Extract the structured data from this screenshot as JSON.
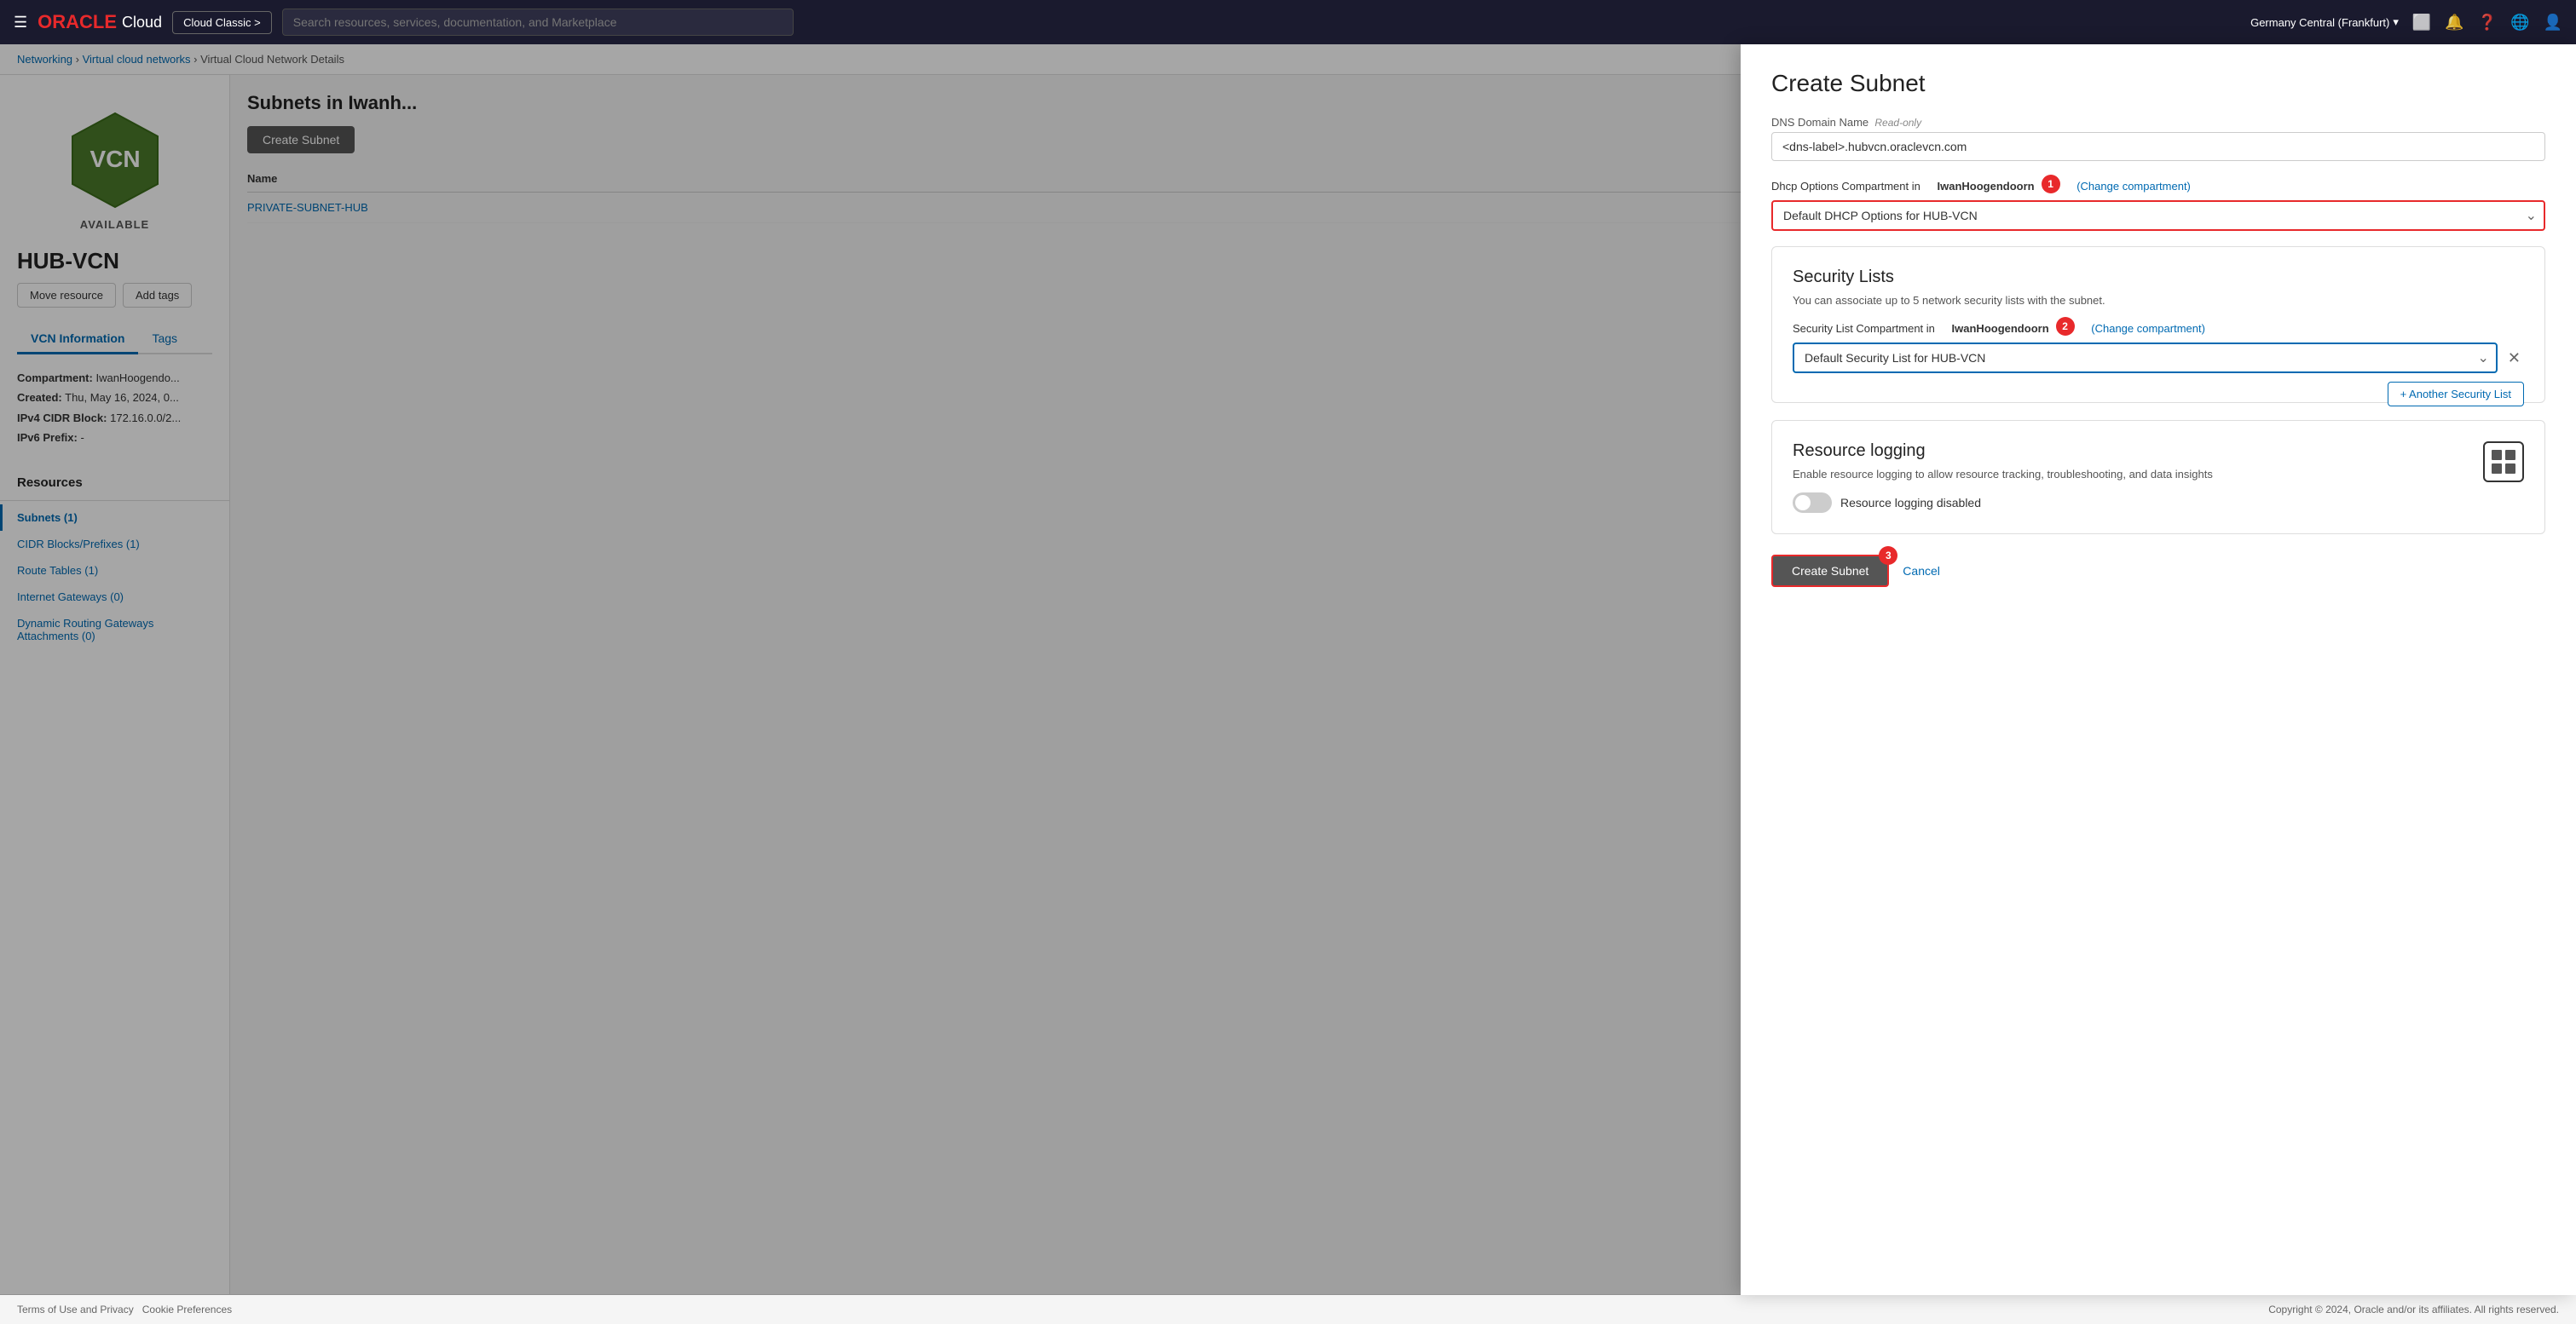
{
  "topnav": {
    "hamburger": "☰",
    "logo_oracle": "ORACLE",
    "logo_cloud": "Cloud",
    "classic_btn": "Cloud Classic >",
    "search_placeholder": "Search resources, services, documentation, and Marketplace",
    "region": "Germany Central (Frankfurt)",
    "region_arrow": "▾"
  },
  "breadcrumb": {
    "networking": "Networking",
    "separator1": " › ",
    "vcn": "Virtual cloud networks",
    "separator2": " › ",
    "detail": "Virtual Cloud Network Details"
  },
  "sidebar": {
    "vcn_label": "VCN",
    "vcn_status": "AVAILABLE",
    "vcn_title": "HUB-VCN",
    "move_resource": "Move resource",
    "add_tags": "Add tags",
    "tab_info": "VCN Information",
    "tab_tags": "Tags",
    "compartment_label": "Compartment:",
    "compartment_value": "IwanHoogendo...",
    "created_label": "Created:",
    "created_value": "Thu, May 16, 2024, 0...",
    "ipv4_label": "IPv4 CIDR Block:",
    "ipv4_value": "172.16.0.0/2...",
    "ipv6_label": "IPv6 Prefix:",
    "ipv6_value": "-",
    "resources_title": "Resources",
    "resource_items": [
      {
        "label": "Subnets (1)",
        "active": true
      },
      {
        "label": "CIDR Blocks/Prefixes (1)",
        "active": false
      },
      {
        "label": "Route Tables (1)",
        "active": false
      },
      {
        "label": "Internet Gateways (0)",
        "active": false
      },
      {
        "label": "Dynamic Routing Gateways Attachments (0)",
        "active": false
      }
    ]
  },
  "main": {
    "subnets_title": "Subnets in Iwanh...",
    "create_subnet_btn": "Create Subnet",
    "table_col_name": "Name",
    "subnet_link": "PRIVATE-SUBNET-HUB"
  },
  "panel": {
    "title": "Create Subnet",
    "dns_label": "DNS Domain Name",
    "dns_readonly": "Read-only",
    "dns_value": "<dns-label>.hubvcn.oraclevcn.com",
    "dhcp_compartment_label": "Dhcp Options Compartment in",
    "dhcp_compartment_owner": "IwanHoogendoorn",
    "dhcp_change_compartment": "(Change compartment)",
    "dhcp_option_value": "Default DHCP Options for HUB-VCN",
    "step1_num": "1",
    "security_lists_title": "Security Lists",
    "security_lists_desc": "You can associate up to 5 network security lists with the subnet.",
    "security_list_compartment_label": "Security List Compartment in",
    "security_list_compartment_owner": "IwanHoogendoorn",
    "security_list_change_compartment": "(Change compartment)",
    "security_list_value": "Default Security List for HUB-VCN",
    "step2_num": "2",
    "another_security_list_btn": "+ Another Security List",
    "another_security_list_tooltip": "Another Security List",
    "resource_logging_title": "Resource logging",
    "resource_logging_desc": "Enable resource logging to allow resource tracking, troubleshooting, and data insights",
    "logging_disabled_label": "Resource logging disabled",
    "create_subnet_btn": "Create Subnet",
    "step3_num": "3",
    "cancel_btn": "Cancel"
  },
  "footer": {
    "terms": "Terms of Use and Privacy",
    "cookies": "Cookie Preferences",
    "copyright": "Copyright © 2024, Oracle and/or its affiliates. All rights reserved."
  }
}
